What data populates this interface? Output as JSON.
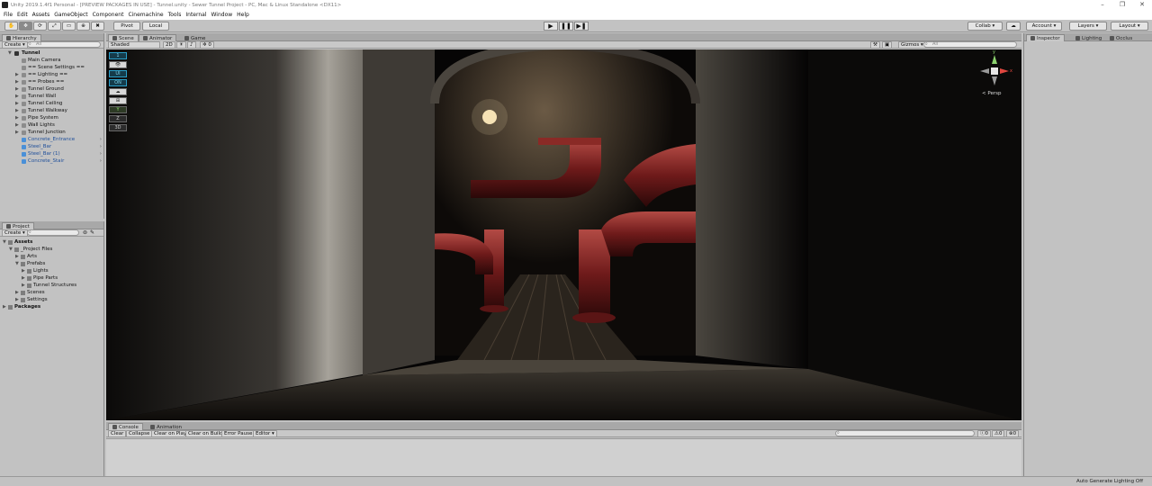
{
  "window": {
    "title": "Unity 2019.1.4f1 Personal - [PREVIEW PACKAGES IN USE] - Tunnel.unity - Sewer Tunnel Project - PC, Mac & Linux Standalone <DX11>",
    "minimize": "–",
    "maximize": "❐",
    "close": "✕"
  },
  "menu": [
    "File",
    "Edit",
    "Assets",
    "GameObject",
    "Component",
    "Cinemachine",
    "Tools",
    "Internal",
    "Window",
    "Help"
  ],
  "toolbar": {
    "tools": [
      "✋",
      "✥",
      "⟳",
      "⤢",
      "▭",
      "⊕",
      "✖"
    ],
    "pivot": "Pivot",
    "local": "Local",
    "play": "▶",
    "pause": "❚❚",
    "step": "▶❚",
    "collab": "Collab ▾",
    "cloud": "☁",
    "account": "Account ▾",
    "layers": "Layers ▾",
    "layout": "Layout ▾"
  },
  "hierarchy": {
    "tab": "Hierarchy",
    "create": "Create ▾",
    "search": "All",
    "root": "Tunnel",
    "items": [
      {
        "label": "Main Camera",
        "type": "go"
      },
      {
        "label": "== Scene Settings ==",
        "type": "go"
      },
      {
        "label": "== Lighting ==",
        "type": "go",
        "expand": true
      },
      {
        "label": "== Probes ==",
        "type": "go",
        "expand": true
      },
      {
        "label": "Tunnel Ground",
        "type": "go",
        "expand": true
      },
      {
        "label": "Tunnel Wall",
        "type": "go",
        "expand": true
      },
      {
        "label": "Tunnel Ceiling",
        "type": "go",
        "expand": true
      },
      {
        "label": "Tunnel Walkway",
        "type": "go",
        "expand": true
      },
      {
        "label": "Pipe System",
        "type": "go",
        "expand": true
      },
      {
        "label": "Wall Lights",
        "type": "go",
        "expand": true
      },
      {
        "label": "Tunnel Junction",
        "type": "go",
        "expand": true
      },
      {
        "label": "Concrete_Entrance",
        "type": "prefab",
        "chev": true
      },
      {
        "label": "Steel_Bar",
        "type": "prefab",
        "chev": true
      },
      {
        "label": "Steel_Bar (1)",
        "type": "prefab",
        "chev": true
      },
      {
        "label": "Concrete_Stair",
        "type": "prefab",
        "chev": true
      }
    ]
  },
  "project": {
    "tab": "Project",
    "create": "Create ▾",
    "items": [
      {
        "label": "Assets",
        "level": 0,
        "bold": true,
        "arrow": "▼"
      },
      {
        "label": "_Project Files",
        "level": 1,
        "arrow": "▼"
      },
      {
        "label": "Arts",
        "level": 2,
        "arrow": "▶"
      },
      {
        "label": "Prefabs",
        "level": 2,
        "arrow": "▼"
      },
      {
        "label": "Lights",
        "level": 3,
        "arrow": "▶"
      },
      {
        "label": "Pipe Parts",
        "level": 3,
        "arrow": "▶"
      },
      {
        "label": "Tunnel Structures",
        "level": 3,
        "arrow": "▶"
      },
      {
        "label": "Scenes",
        "level": 2,
        "arrow": "▶"
      },
      {
        "label": "Settings",
        "level": 2,
        "arrow": "▶"
      },
      {
        "label": "Packages",
        "level": 0,
        "bold": true,
        "arrow": "▶"
      }
    ]
  },
  "scene_tabs": {
    "scene": "Scene",
    "animator": "Animator",
    "game": "Game"
  },
  "scene_bar": {
    "shading": "Shaded",
    "mode2d": "2D",
    "fx": "0",
    "gizmos": "Gizmos ▾",
    "search": "All"
  },
  "scene_icons": [
    "1",
    "👁",
    "UI",
    "ON",
    "☁",
    "⊞",
    "Y",
    "Z",
    "3D"
  ],
  "scene_gizmo": {
    "y": "y",
    "x": "x",
    "persp": "< Persp"
  },
  "inspector": {
    "tabs": [
      "Inspector",
      "Lighting",
      "Occlus"
    ]
  },
  "console": {
    "tabs": [
      "Console",
      "Animation"
    ],
    "buttons": [
      "Clear",
      "Collapse",
      "Clear on Play",
      "Clear on Build",
      "Error Pause",
      "Editor ▾"
    ],
    "counts": [
      "0",
      "0",
      "0"
    ]
  },
  "status": {
    "text": "Auto Generate Lighting Off"
  },
  "colors": {
    "pipe": "#7a1c1c",
    "stone": "#5a5650",
    "selection": "#3b6fc2"
  }
}
